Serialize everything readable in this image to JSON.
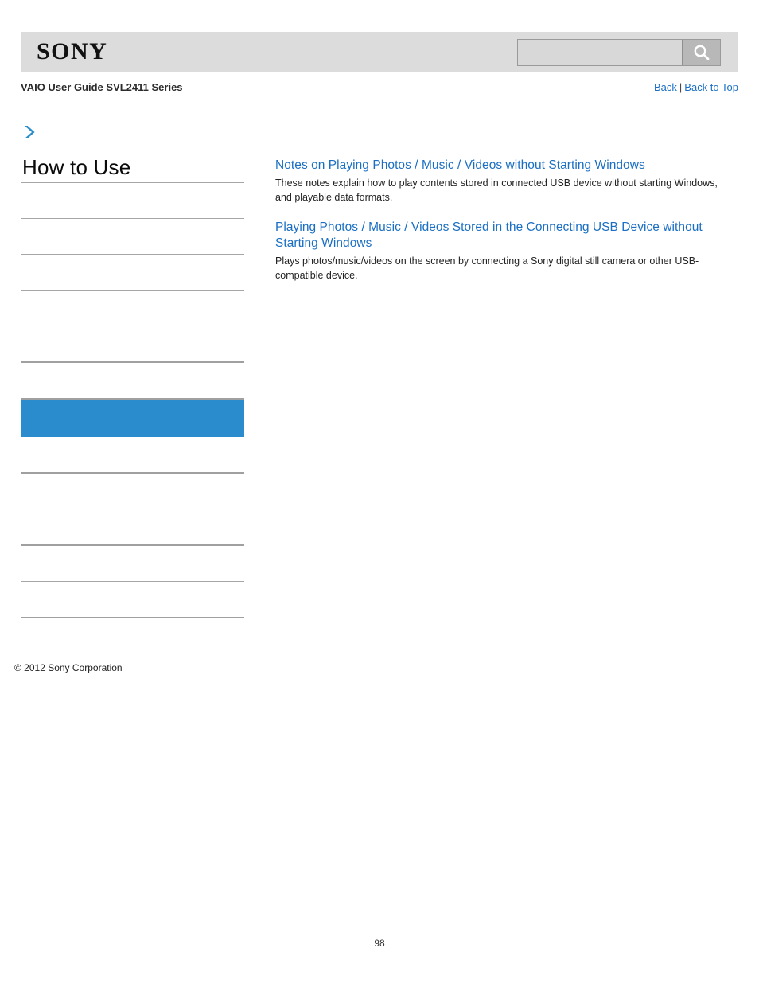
{
  "header": {
    "logo_text": "SONY",
    "search": {
      "value": "",
      "placeholder": "",
      "button_icon": "search-icon"
    }
  },
  "title_row": {
    "guide_title": "VAIO User Guide SVL2411 Series",
    "back_label": "Back",
    "separator": "|",
    "back_to_top_label": "Back to Top"
  },
  "sidebar": {
    "arrow_icon": "chevron-right-icon",
    "heading": "How to Use",
    "items": [
      {
        "label": ""
      },
      {
        "label": ""
      },
      {
        "label": ""
      },
      {
        "label": ""
      },
      {
        "label": ""
      },
      {
        "label": "",
        "active": true
      },
      {
        "label": ""
      },
      {
        "label": ""
      },
      {
        "label": ""
      },
      {
        "label": ""
      },
      {
        "label": ""
      }
    ]
  },
  "content": {
    "entries": [
      {
        "title": "Notes on Playing Photos / Music / Videos without Starting Windows",
        "description": "These notes explain how to play contents stored in connected USB device without starting Windows, and playable data formats."
      },
      {
        "title": "Playing Photos / Music / Videos Stored in the Connecting USB Device without Starting Windows",
        "description": "Plays photos/music/videos on the screen by connecting a Sony digital still camera or other USB-compatible device."
      }
    ]
  },
  "footer": {
    "copyright": "© 2012 Sony Corporation",
    "page_number": "98"
  },
  "colors": {
    "link_blue": "#1a6fc4",
    "accent_blue": "#2a8ccd",
    "header_gray": "#dcdcdc"
  }
}
